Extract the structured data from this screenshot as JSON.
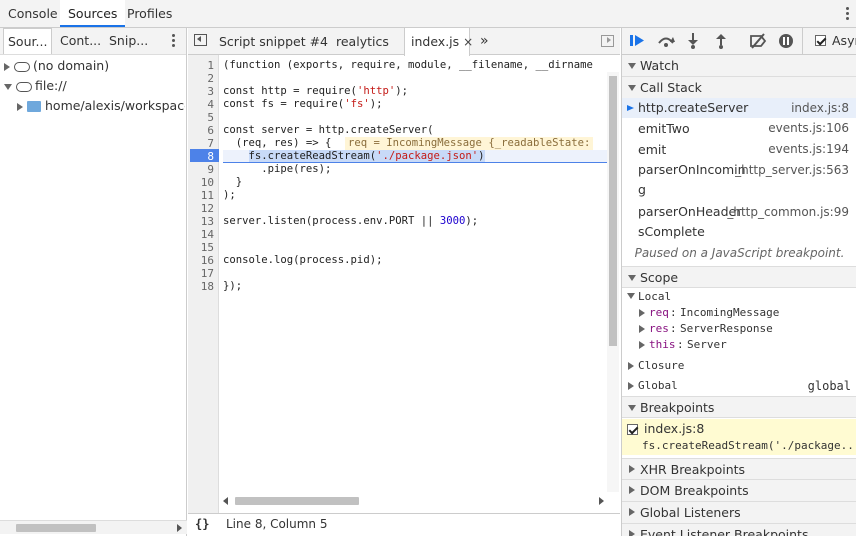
{
  "top_tabs": [
    "Console",
    "Sources",
    "Profiles"
  ],
  "navigator": {
    "tabs": [
      "Sour...",
      "Cont...",
      "Snip..."
    ],
    "tree": [
      {
        "label": "(no domain)"
      },
      {
        "label": "file://"
      },
      {
        "label": "home/alexis/workspace/l"
      }
    ]
  },
  "editor": {
    "tabs": [
      "Script snippet #4",
      "realytics",
      "index.js"
    ],
    "overflow": "»",
    "line_numbers": [
      "1",
      "2",
      "3",
      "4",
      "5",
      "6",
      "7",
      "8",
      "9",
      "10",
      "11",
      "12",
      "13",
      "14",
      "15",
      "16",
      "17",
      "18"
    ],
    "lines": [
      "(function (exports, require, module, __filename, __dirname",
      "",
      "const http = require('http');",
      "const fs = require('fs');",
      "",
      "const server = http.createServer(",
      "  (req, res) => {",
      "    fs.createReadStream('./package.json')",
      "      .pipe(res);",
      "  }",
      ");",
      "",
      "server.listen(process.env.PORT || 3000);",
      "",
      "",
      "console.log(process.pid);",
      "",
      "});"
    ],
    "inline_hint": "req = IncomingMessage {_readableState:",
    "status": "Line 8, Column 5",
    "format_button": "{}"
  },
  "sidebar": {
    "async_label": "Asyn",
    "watch_label": "Watch",
    "call_stack_label": "Call Stack",
    "call_stack": [
      {
        "fn": "http.createServer",
        "loc": "index.js:8"
      },
      {
        "fn": "emitTwo",
        "loc": "events.js:106"
      },
      {
        "fn": "emit",
        "loc": "events.js:194"
      },
      {
        "fn": "parserOnIncomin",
        "fn2": "g",
        "loc": "_http_server.js:563"
      },
      {
        "fn": "parserOnHeader",
        "fn2": "sComplete",
        "loc": "_http_common.js:99"
      }
    ],
    "paused_message": "Paused on a JavaScript breakpoint.",
    "scope_label": "Scope",
    "scope_local": "Local",
    "scope_vars": [
      {
        "name": "req",
        "value": "IncomingMessage"
      },
      {
        "name": "res",
        "value": "ServerResponse"
      },
      {
        "name": "this",
        "value": "Server"
      }
    ],
    "scope_closure": "Closure",
    "scope_global": "Global",
    "scope_global_value": "global",
    "breakpoints_label": "Breakpoints",
    "breakpoint_file": "index.js:8",
    "breakpoint_code": "fs.createReadStream('./package....",
    "xhr_label": "XHR Breakpoints",
    "dom_label": "DOM Breakpoints",
    "listeners_label": "Global Listeners",
    "event_label": "Event Listener Breakpoints"
  }
}
